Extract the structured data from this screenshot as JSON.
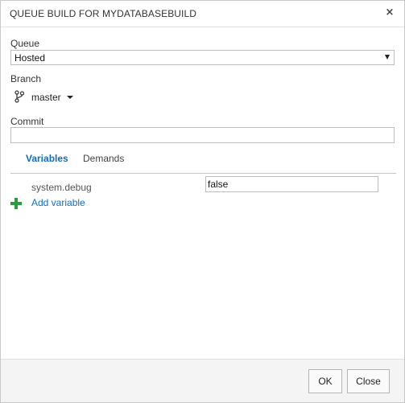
{
  "dialog": {
    "title": "QUEUE BUILD FOR MYDATABASEBUILD",
    "close_glyph": "×"
  },
  "queue": {
    "label": "Queue",
    "selected": "Hosted"
  },
  "branch": {
    "label": "Branch",
    "selected": "master",
    "icon": "git-branch-icon"
  },
  "commit": {
    "label": "Commit",
    "value": ""
  },
  "tabs": [
    {
      "label": "Variables",
      "active": true
    },
    {
      "label": "Demands",
      "active": false
    }
  ],
  "variables": [
    {
      "name": "system.debug",
      "value": "false"
    }
  ],
  "add_variable": {
    "label": "Add variable",
    "icon": "plus-icon"
  },
  "footer": {
    "ok_label": "OK",
    "close_label": "Close"
  },
  "colors": {
    "accent": "#106ebe",
    "add_icon": "#2e9a3f"
  }
}
